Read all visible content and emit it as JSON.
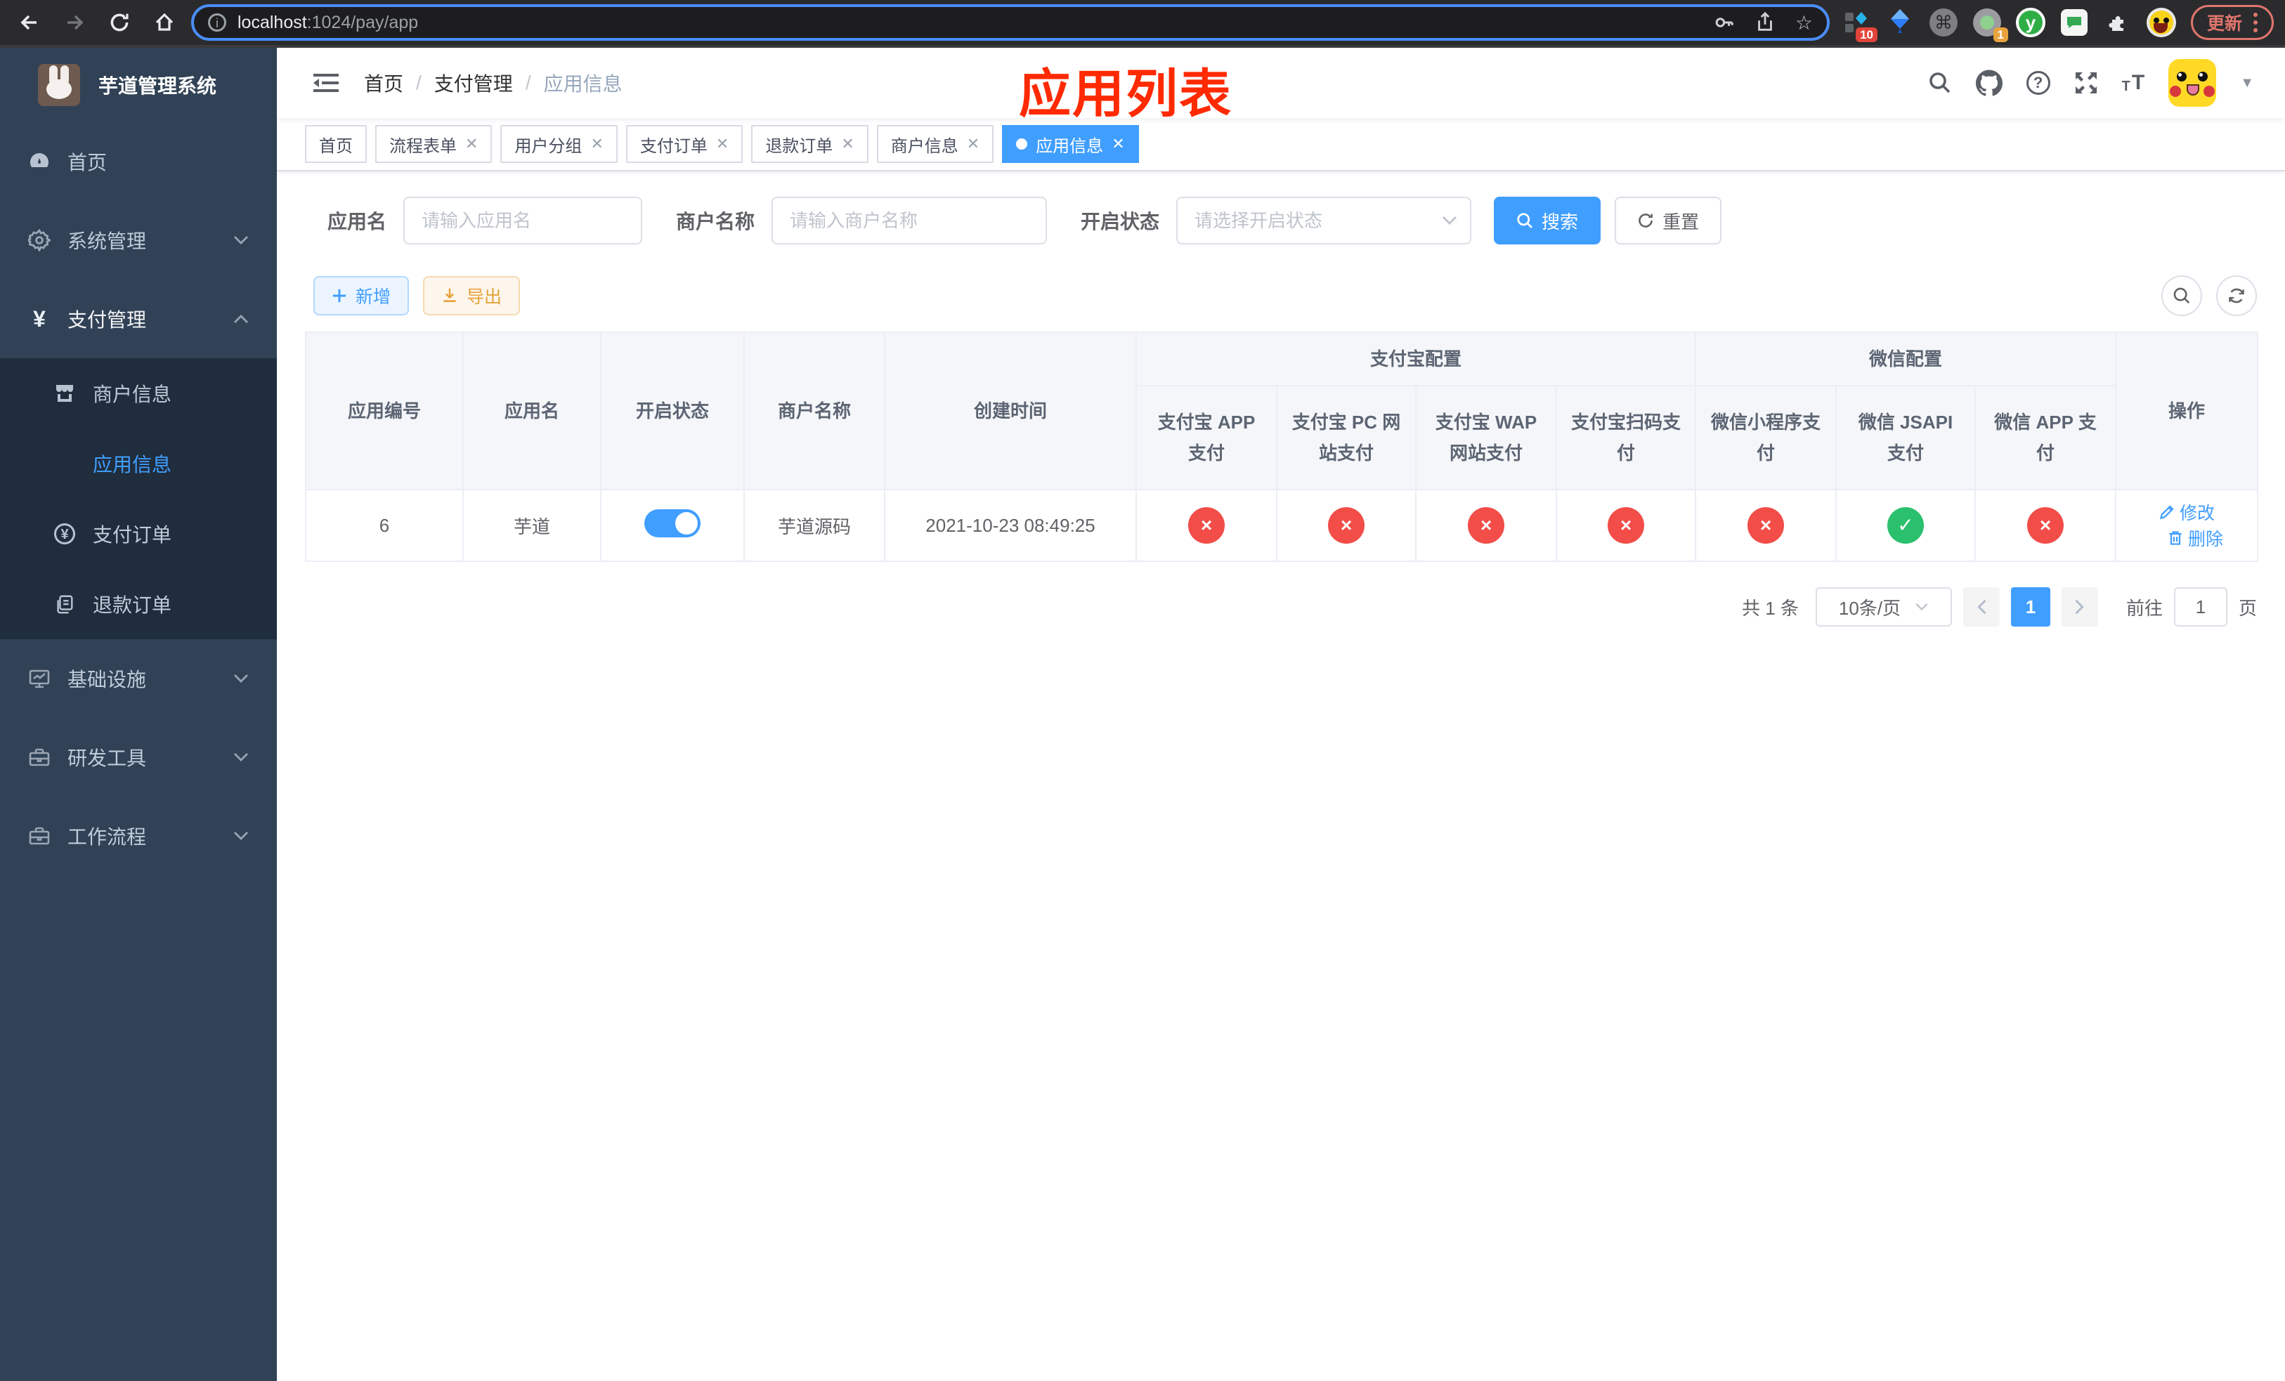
{
  "browser": {
    "url_host": "localhost",
    "url_path": ":1024/pay/app",
    "update_label": "更新",
    "ext_badge_ten": "10",
    "ext_badge_one": "1",
    "ext_green_letter": "y",
    "cmd_glyph": "⌘",
    "star_glyph": "☆"
  },
  "sidebar": {
    "title": "芋道管理系统",
    "items": [
      {
        "label": "首页",
        "icon": "dashboard-icon"
      },
      {
        "label": "系统管理",
        "icon": "gear-icon",
        "expandable": true
      },
      {
        "label": "支付管理",
        "icon": "yen-icon",
        "expandable": true,
        "expanded": true,
        "children": [
          {
            "label": "商户信息",
            "icon": "shop-icon"
          },
          {
            "label": "应用信息",
            "icon": "grid-icon",
            "active": true
          },
          {
            "label": "支付订单",
            "icon": "yen-circle-icon"
          },
          {
            "label": "退款订单",
            "icon": "document-icon"
          }
        ]
      },
      {
        "label": "基础设施",
        "icon": "monitor-icon",
        "expandable": true
      },
      {
        "label": "研发工具",
        "icon": "toolbox-icon",
        "expandable": true
      },
      {
        "label": "工作流程",
        "icon": "toolbox-icon",
        "expandable": true
      }
    ]
  },
  "header": {
    "breadcrumb": [
      "首页",
      "支付管理",
      "应用信息"
    ],
    "annotation": "应用列表",
    "annotation_color": "#ff2a00"
  },
  "tabs": {
    "items": [
      {
        "label": "首页",
        "closable": false,
        "active": false
      },
      {
        "label": "流程表单",
        "closable": true,
        "active": false
      },
      {
        "label": "用户分组",
        "closable": true,
        "active": false
      },
      {
        "label": "支付订单",
        "closable": true,
        "active": false
      },
      {
        "label": "退款订单",
        "closable": true,
        "active": false
      },
      {
        "label": "商户信息",
        "closable": true,
        "active": false
      },
      {
        "label": "应用信息",
        "closable": true,
        "active": true
      }
    ]
  },
  "filters": {
    "app_name_label": "应用名",
    "app_name_placeholder": "请输入应用名",
    "app_name_value": "",
    "merchant_label": "商户名称",
    "merchant_placeholder": "请输入商户名称",
    "merchant_value": "",
    "status_label": "开启状态",
    "status_placeholder": "请选择开启状态",
    "search_label": "搜索",
    "reset_label": "重置"
  },
  "toolbar": {
    "add_label": "新增",
    "export_label": "导出"
  },
  "table": {
    "columns": [
      "应用编号",
      "应用名",
      "开启状态",
      "商户名称",
      "创建时间"
    ],
    "groups": {
      "alipay": "支付宝配置",
      "wechat": "微信配置"
    },
    "channel_columns": [
      "支付宝 APP 支付",
      "支付宝 PC 网站支付",
      "支付宝 WAP 网站支付",
      "支付宝扫码支付",
      "微信小程序支付",
      "微信 JSAPI 支付",
      "微信 APP 支付"
    ],
    "actions_header": "操作",
    "rows": [
      {
        "id": "6",
        "name": "芋道",
        "status_enabled": true,
        "merchant": "芋道源码",
        "created": "2021-10-23 08:49:25",
        "channels": [
          {
            "name": "alipay-app",
            "enabled": false
          },
          {
            "name": "alipay-pc",
            "enabled": false
          },
          {
            "name": "alipay-wap",
            "enabled": false
          },
          {
            "name": "alipay-qrcode",
            "enabled": false
          },
          {
            "name": "wechat-miniapp",
            "enabled": false
          },
          {
            "name": "wechat-jsapi",
            "enabled": true
          },
          {
            "name": "wechat-app",
            "enabled": false
          }
        ],
        "actions": [
          "修改",
          "删除"
        ]
      }
    ]
  },
  "pagination": {
    "total": "共 1 条",
    "page_size": "10条/页",
    "current": "1",
    "goto_prefix": "前往",
    "goto_value": "1",
    "goto_suffix": "页"
  },
  "icons": {
    "check_glyph": "✓",
    "cross_glyph": "×"
  },
  "colors": {
    "accent": "#409eff",
    "success": "#2bc06d",
    "danger": "#f24d48",
    "warning": "#e6a23c",
    "sidebar_bg": "#314256",
    "submenu_bg": "#1f2d3d"
  }
}
